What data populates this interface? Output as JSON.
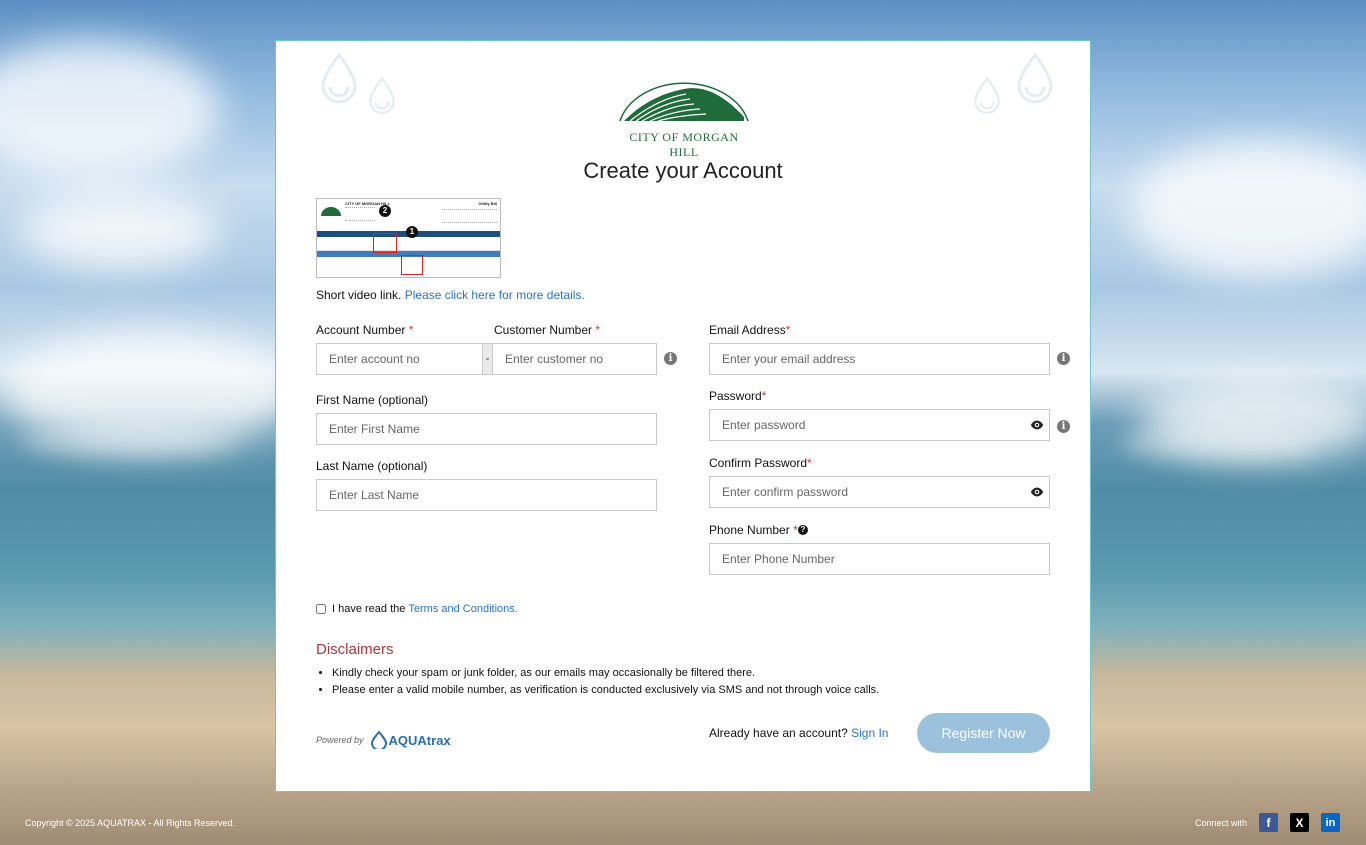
{
  "logo": {
    "name": "CITY OF MORGAN HILL",
    "color": "#1f6b3a"
  },
  "page": {
    "title": "Create your Account"
  },
  "bill_image": {
    "alt": "Sample utility bill",
    "header": "CITY OF MORGAN HILL",
    "badge": "Utility Bill",
    "marker_one": "1",
    "marker_two": "2"
  },
  "short_video": {
    "text": "Short video link.",
    "link": "Please click here for more details."
  },
  "form": {
    "account_number": {
      "label": "Account Number",
      "required": "*",
      "placeholder": "Enter account no"
    },
    "separator": "-",
    "customer_number": {
      "label": "Customer Number",
      "required": "*",
      "placeholder": "Enter customer no"
    },
    "first_name": {
      "label": "First Name (optional)",
      "placeholder": "Enter First Name"
    },
    "last_name": {
      "label": "Last Name (optional)",
      "placeholder": "Enter Last Name"
    },
    "email": {
      "label": "Email Address",
      "required": "*",
      "placeholder": "Enter your email address"
    },
    "password": {
      "label": "Password",
      "required": "*",
      "placeholder": "Enter password"
    },
    "confirm_password": {
      "label": "Confirm Password",
      "required": "*",
      "placeholder": "Enter confirm password"
    },
    "phone": {
      "label": "Phone Number",
      "required": "*",
      "placeholder": "Enter Phone Number"
    }
  },
  "terms": {
    "text": "I have read the",
    "link": "Terms and Conditions."
  },
  "disclaimers": {
    "title": "Disclaimers",
    "items": [
      "Kindly check your spam or junk folder, as our emails may occasionally be filtered there.",
      "Please enter a valid mobile number, as verification is conducted exclusively via SMS and not through voice calls."
    ]
  },
  "powered_by": {
    "text": "Powered by",
    "brand": "AQUAtrax"
  },
  "signin": {
    "text": "Already have an account?",
    "link": "Sign In"
  },
  "register_button": "Register Now",
  "footer": {
    "copyright": "Copyright © 2025 AQUATRAX - All Rights Reserved.",
    "connect": "Connect with",
    "facebook": "f",
    "x": "X",
    "linkedin": "in"
  },
  "colors": {
    "accent_link": "#2a74c8",
    "disclaimer_title": "#b0343b",
    "register_button": "#9cc1dc",
    "facebook": "#3b5998",
    "x": "#000000",
    "linkedin": "#0a66c2"
  },
  "icons": [
    "water-drop-icon",
    "info-icon",
    "eye-icon",
    "help-icon",
    "facebook-icon",
    "x-icon",
    "linkedin-icon"
  ]
}
